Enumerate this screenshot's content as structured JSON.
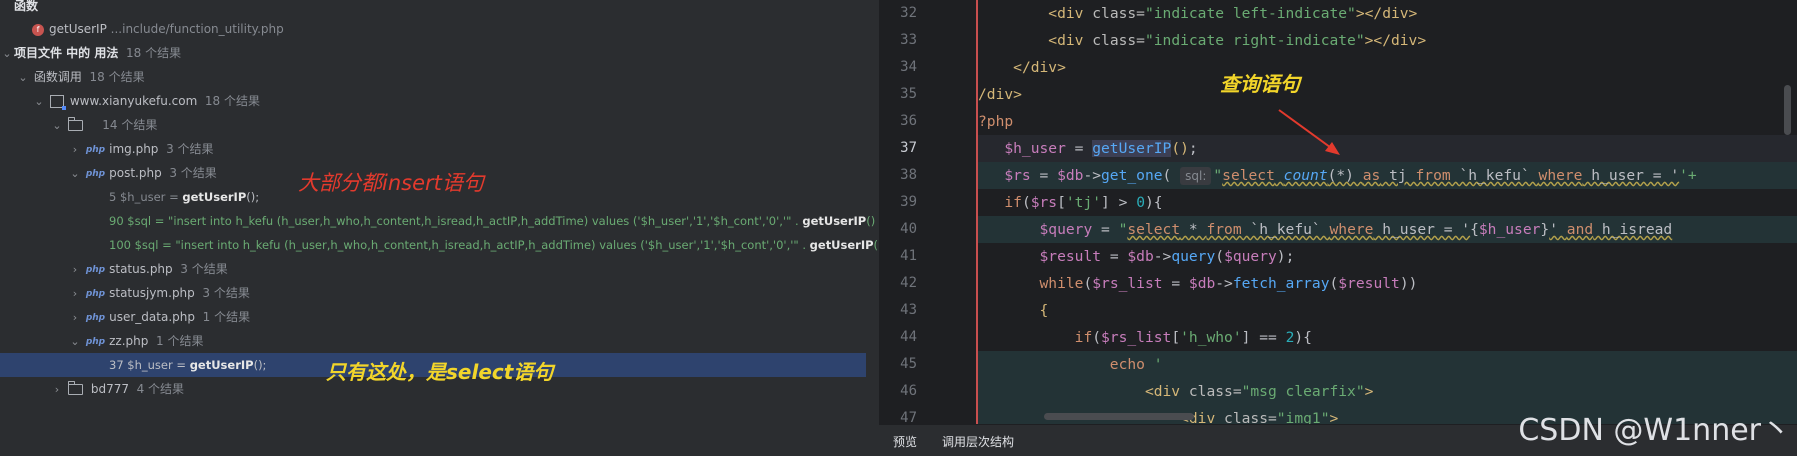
{
  "find_panel": {
    "functions_header": "函数",
    "func_name": "getUserIP",
    "func_path": "...include/function_utility.php",
    "usages_label": "项目文件 中的 用法",
    "usages_count": "18 个结果",
    "calls_label": "函数调用",
    "calls_count": "18 个结果",
    "module_label": "www.xianyukefu.com",
    "module_count": "18 个结果",
    "folder_count": "14 个结果",
    "files": [
      {
        "name": "img.php",
        "count": "3 个结果"
      },
      {
        "name": "post.php",
        "count": "3 个结果"
      },
      {
        "name": "status.php",
        "count": "3 个结果"
      },
      {
        "name": "statusjym.php",
        "count": "3 个结果"
      },
      {
        "name": "user_data.php",
        "count": "1 个结果"
      },
      {
        "name": "zz.php",
        "count": "1 个结果"
      }
    ],
    "post_results": [
      {
        "pre": "5 $h_user = ",
        "hl": "getUserIP",
        "post": "();"
      },
      {
        "pre": "90 $sql = \"insert into h_kefu (h_user,h_who,h_content,h_isread,h_actIP,h_addTime) values ('$h_user','1','$h_cont','0','\" . ",
        "hl": "getUserIP",
        "post": "() . \"','\""
      },
      {
        "pre": "100 $sql = \"insert into h_kefu (h_user,h_who,h_content,h_isread,h_actIP,h_addTime) values ('$h_user','1','$h_cont','0','\" . ",
        "hl": "getUserIP",
        "post": "() . \"','"
      }
    ],
    "zz_result": {
      "pre": "37 $h_user = ",
      "hl": "getUserIP",
      "post": "();"
    },
    "bd_label": "bd777",
    "bd_count": "4 个结果"
  },
  "annotations": {
    "insert_note": "大部分都insert语句",
    "select_note": "只有这处，是select语句",
    "query_note": "查询语句"
  },
  "editor": {
    "line_numbers": [
      "32",
      "33",
      "34",
      "35",
      "36",
      "37",
      "38",
      "39",
      "40",
      "41",
      "42",
      "43",
      "44",
      "45",
      "46",
      "47"
    ],
    "sql_hint": "sql:",
    "php_open": "?php",
    "div_close_indent": "</div>",
    "div_close": "/div>"
  },
  "bottom_tabs": {
    "preview": "预览",
    "hierarchy": "调用层次结构"
  },
  "watermark": "CSDN @W1nner丶"
}
